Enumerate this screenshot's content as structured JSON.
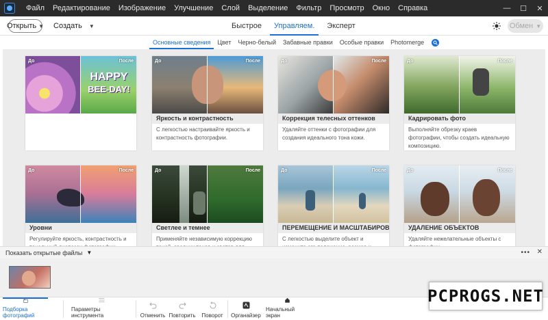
{
  "menu": [
    "Файл",
    "Редактирование",
    "Изображение",
    "Улучшение",
    "Слой",
    "Выделение",
    "Фильтр",
    "Просмотр",
    "Окно",
    "Справка"
  ],
  "window_controls": {
    "minimize": "—",
    "maximize": "☐",
    "close": "✕"
  },
  "toolbar": {
    "open_label": "Открыть",
    "create_label": "Создать",
    "mode_tabs": [
      "Быстрое",
      "Управляем.",
      "Эксперт"
    ],
    "active_mode": 1,
    "share_label": "Обмен"
  },
  "subtabs": [
    "Основные сведения",
    "Цвет",
    "Черно-белый",
    "Забавные правки",
    "Особые правки",
    "Photomerge"
  ],
  "active_subtab": 0,
  "cards": [
    {
      "title": "",
      "desc": "",
      "before": "До",
      "after": "После"
    },
    {
      "title": "Яркость и контрастность",
      "desc": "С легкостью настраивайте яркость и контрастность фотографии.",
      "before": "До",
      "after": "После"
    },
    {
      "title": "Коррекция телесных оттенков",
      "desc": "Удаляйте оттенки с фотографии для создания идеального тона кожи.",
      "before": "До",
      "after": "После"
    },
    {
      "title": "Кадрировать фото",
      "desc": "Выполняйте обрезку краев фотографии, чтобы создать идеальную композицию.",
      "before": "До",
      "after": "После"
    },
    {
      "title": "Уровни",
      "desc": "Регулируйте яркость, контрастность и тональный диапазон фотографии.",
      "before": "До",
      "after": "После"
    },
    {
      "title": "Светлее и темнее",
      "desc": "Применяйте независимую коррекцию теней, средних тонов и светов для создания",
      "before": "До",
      "after": "После"
    },
    {
      "title": "ПЕРЕМЕЩЕНИЕ И МАСШТАБИРОВА...",
      "desc": "С легкостью выделите объект и измените его положение, размер и многое другое",
      "before": "До",
      "after": "После"
    },
    {
      "title": "УДАЛЕНИЕ ОБЪЕКТОВ",
      "desc": "Удаляйте нежелательные объекты с фотографии.",
      "before": "До",
      "after": "После"
    }
  ],
  "card0_overlay": {
    "line1": "HAPPY",
    "line2": "BEE-DAY!"
  },
  "bin": {
    "label": "Показать открытые файлы"
  },
  "bottom": [
    {
      "label": "Подборка фотографий"
    },
    {
      "label": "Параметры инструмента"
    },
    {
      "label": "Отменить"
    },
    {
      "label": "Повторить"
    },
    {
      "label": "Поворот"
    },
    {
      "label": "Органайзер"
    },
    {
      "label": "Начальный экран"
    }
  ],
  "watermark": "PCPROGS.NET",
  "colors": {
    "accent": "#1a6fd6",
    "menubar": "#2b2b2b"
  }
}
